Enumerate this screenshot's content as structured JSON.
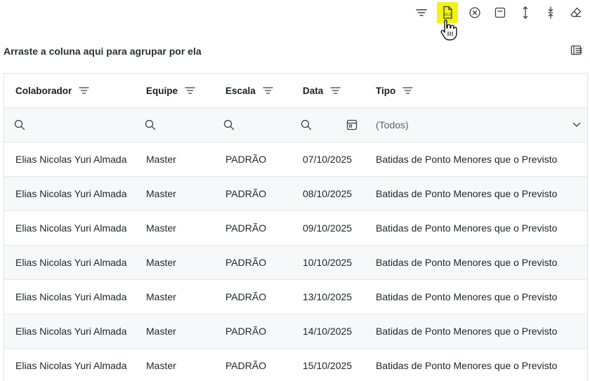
{
  "toolbar": {
    "buttons": [
      {
        "id": "btn-filter",
        "icon": "filter-lines-icon"
      },
      {
        "id": "btn-export",
        "icon": "export-xls-icon",
        "active": true
      },
      {
        "id": "btn-clear",
        "icon": "circle-x-icon"
      },
      {
        "id": "btn-layout",
        "icon": "layout-icon"
      },
      {
        "id": "btn-expand",
        "icon": "expand-vertical-icon"
      },
      {
        "id": "btn-collapse",
        "icon": "collapse-vertical-icon"
      },
      {
        "id": "btn-erase",
        "icon": "eraser-icon"
      }
    ],
    "active_color": "#f2f21a"
  },
  "group_panel": {
    "text": "Arraste a coluna aqui para agrupar por ela"
  },
  "grid": {
    "columns": [
      "Colaborador",
      "Equipe",
      "Escala",
      "Data",
      "Tipo"
    ],
    "filter": {
      "tipo_value": "(Todos)"
    },
    "rows": [
      [
        "Elias Nicolas Yuri Almada",
        "Master",
        "PADRÃO",
        "07/10/2025",
        "Batidas de Ponto Menores que o Previsto"
      ],
      [
        "Elias Nicolas Yuri Almada",
        "Master",
        "PADRÃO",
        "08/10/2025",
        "Batidas de Ponto Menores que o Previsto"
      ],
      [
        "Elias Nicolas Yuri Almada",
        "Master",
        "PADRÃO",
        "09/10/2025",
        "Batidas de Ponto Menores que o Previsto"
      ],
      [
        "Elias Nicolas Yuri Almada",
        "Master",
        "PADRÃO",
        "10/10/2025",
        "Batidas de Ponto Menores que o Previsto"
      ],
      [
        "Elias Nicolas Yuri Almada",
        "Master",
        "PADRÃO",
        "13/10/2025",
        "Batidas de Ponto Menores que o Previsto"
      ],
      [
        "Elias Nicolas Yuri Almada",
        "Master",
        "PADRÃO",
        "14/10/2025",
        "Batidas de Ponto Menores que o Previsto"
      ],
      [
        "Elias Nicolas Yuri Almada",
        "Master",
        "PADRÃO",
        "15/10/2025",
        "Batidas de Ponto Menores que o Previsto"
      ]
    ]
  }
}
